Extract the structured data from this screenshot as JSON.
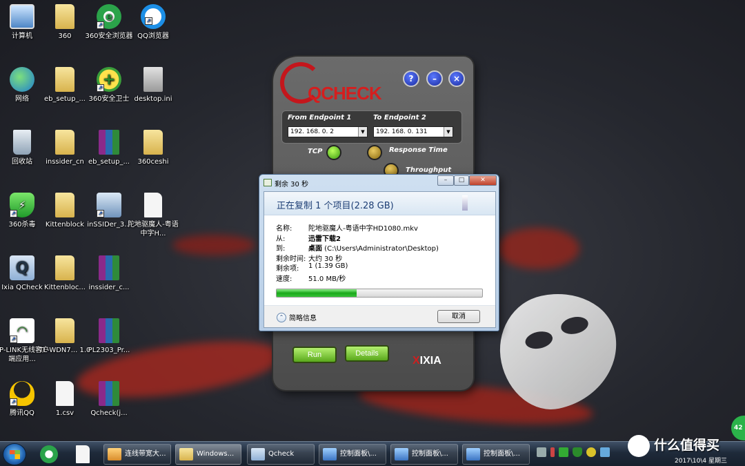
{
  "desktop_icons": [
    {
      "label": "计算机",
      "icon": "computer-icon"
    },
    {
      "label": "360",
      "icon": "folder-icon"
    },
    {
      "label": "360安全浏览器",
      "icon": "browser-360-icon"
    },
    {
      "label": "QQ浏览器",
      "icon": "qq-browser-icon"
    },
    {
      "label": "网络",
      "icon": "network-icon"
    },
    {
      "label": "eb_setup_...",
      "icon": "folder-icon"
    },
    {
      "label": "360安全卫士",
      "icon": "security-360-icon"
    },
    {
      "label": "desktop.ini",
      "icon": "ini-file-icon"
    },
    {
      "label": "回收站",
      "icon": "recycle-bin-icon"
    },
    {
      "label": "inssider_cn",
      "icon": "folder-icon"
    },
    {
      "label": "eb_setup_...",
      "icon": "archive-icon"
    },
    {
      "label": "360ceshi",
      "icon": "folder-icon"
    },
    {
      "label": "360杀毒",
      "icon": "antivirus-360-icon"
    },
    {
      "label": "Kittenblock",
      "icon": "folder-icon"
    },
    {
      "label": "inSSIDer_3...",
      "icon": "setup-icon"
    },
    {
      "label": "陀地驱魔人-粤语中字H...",
      "icon": "video-file-icon"
    },
    {
      "label": "Ixia QCheck",
      "icon": "qcheck-icon"
    },
    {
      "label": "Kittenbloc...",
      "icon": "folder-icon"
    },
    {
      "label": "inssider_c...",
      "icon": "archive-icon"
    },
    {
      "label": "TP-LINK无线客户端应用...",
      "icon": "wifi-client-icon"
    },
    {
      "label": "TL-WDN7... 1.0",
      "icon": "folder-icon"
    },
    {
      "label": "PL2303_Pr...",
      "icon": "archive-icon"
    },
    {
      "label": "腾讯QQ",
      "icon": "qq-icon"
    },
    {
      "label": "1.csv",
      "icon": "csv-file-icon"
    },
    {
      "label": "Qcheck(j...",
      "icon": "archive-icon"
    }
  ],
  "qcheck": {
    "brand": "QCHECK",
    "help": "?",
    "minimize": "–",
    "close": "×",
    "from_label": "From Endpoint 1",
    "to_label": "To Endpoint 2",
    "from_value": "192. 168. 0. 2",
    "to_value": "192. 168. 0. 131",
    "protocol_tcp": "TCP",
    "response_time": "Response Time",
    "throughput": "Throughput",
    "run": "Run",
    "details": "Details",
    "vendor": "IXIA",
    "vendor_mark": "X"
  },
  "copy_dialog": {
    "title": "剩余 30 秒",
    "heading": "正在复制 1 个项目(2.28 GB)",
    "rows": [
      {
        "key": "名称:",
        "value": "陀地驱魔人-粤语中字HD1080.mkv",
        "bold": ""
      },
      {
        "key": "从:",
        "value": "",
        "bold": "迅雷下载2"
      },
      {
        "key": "到:",
        "value": " (C:\\Users\\Administrator\\Desktop)",
        "bold": "桌面"
      },
      {
        "key": "剩余时间:",
        "value": "大约 30 秒",
        "bold": ""
      },
      {
        "key": "剩余项:",
        "value": "1 (1.39 GB)",
        "bold": ""
      },
      {
        "key": "速度:",
        "value": "51.0 MB/秒",
        "bold": ""
      }
    ],
    "progress": 0.39,
    "more_info": "简略信息",
    "cancel": "取消"
  },
  "taskbar": {
    "items": [
      {
        "label": "连线带宽大...",
        "active": false
      },
      {
        "label": "Windows...",
        "active": true
      },
      {
        "label": "Qcheck",
        "active": false
      },
      {
        "label": "控制面板\\...",
        "active": false
      },
      {
        "label": "控制面板\\...",
        "active": false
      },
      {
        "label": "控制面板\\...",
        "active": false
      }
    ],
    "clock": "2017\\10\\4 星期三",
    "watermark": "什么值得买",
    "badge": "42"
  }
}
